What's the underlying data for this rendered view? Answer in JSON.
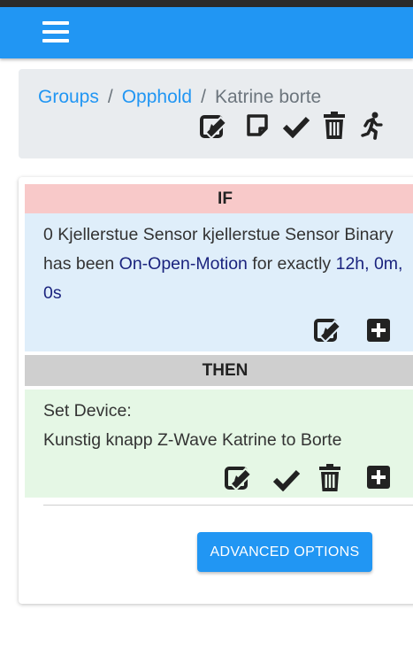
{
  "navbar": {
    "menu_icon": "hamburger-icon",
    "color": "#2196f3"
  },
  "breadcrumb": {
    "items": [
      {
        "label": "Groups",
        "link": true
      },
      {
        "label": "Opphold",
        "link": true
      },
      {
        "label": "Katrine borte",
        "link": false
      }
    ],
    "separator": "/",
    "tools": [
      "edit-icon",
      "note-icon",
      "check-icon",
      "trash-icon",
      "running-man-icon"
    ]
  },
  "rule": {
    "if_label": "IF",
    "condition": {
      "prefix": "0 Kjellerstue Sensor kjellerstue Sensor Binary has been ",
      "state": "On-Open-Motion",
      "middle": " for exactly ",
      "duration": "12h, 0m, 0s"
    },
    "condition_tools": [
      "edit-icon",
      "plus-icon"
    ],
    "then_label": "THEN",
    "action": {
      "line1": "Set Device:",
      "line2": "Kunstig knapp Z-Wave Katrine to Borte"
    },
    "action_tools": [
      "edit-icon",
      "check-icon",
      "trash-icon",
      "plus-icon"
    ],
    "advanced_button": "ADVANCED OPTIONS"
  },
  "colors": {
    "accent": "#2196f3",
    "if_header": "#f8c9c9",
    "if_body": "#dfeefa",
    "then_header": "#cfcfcf",
    "then_body": "#e5f7e5",
    "value_text": "#1a237e"
  }
}
